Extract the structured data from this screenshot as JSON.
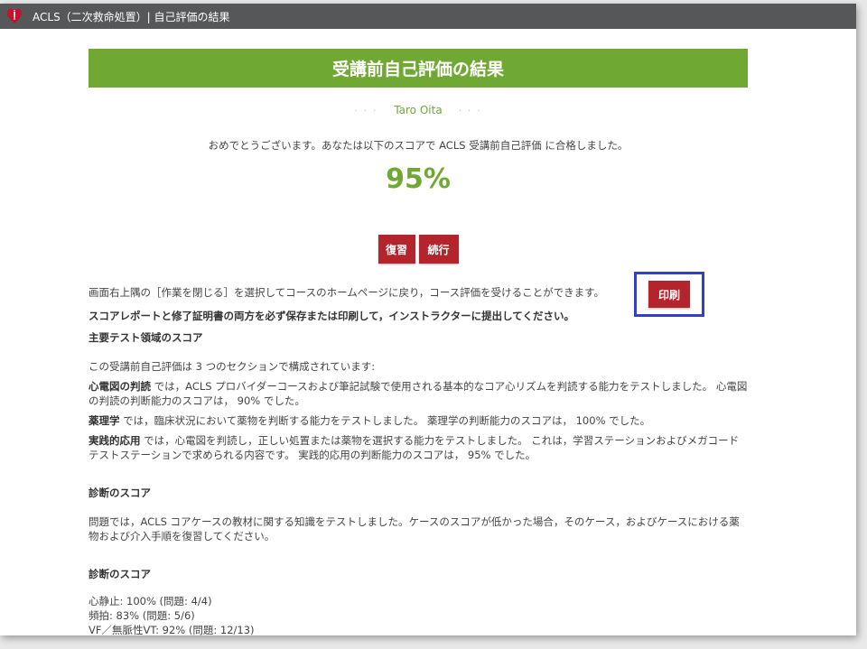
{
  "window": {
    "title": "ACLS（二次救命処置）| 自己評価の結果"
  },
  "banner": {
    "title": "受講前自己評価の結果"
  },
  "user": {
    "name": "Taro Oita"
  },
  "result": {
    "congrats": "おめでとうございます。あなたは以下のスコアで ACLS 受講前自己評価 に合格しました。",
    "score": "95%"
  },
  "buttons": {
    "review": "復習",
    "continue": "続行",
    "print": "印刷"
  },
  "info": {
    "close_instruction": "画面右上隅の［作業を閉じる］を選択してコースのホームページに戻り，コース評価を受けることができます。",
    "save_notice": "スコアレポートと修了証明書の両方を必ず保存または印刷して，インストラクターに提出してください。"
  },
  "sections": {
    "main_heading": "主要テスト領域のスコア",
    "intro": "この受講前自己評価は 3 つのセクションで構成されています:",
    "ecg": {
      "term": "心電図の判読",
      "text": " では，ACLS プロバイダーコースおよび筆記試験で使用される基本的なコア心リズムを判読する能力をテストしました。 心電図の判読の判断能力のスコアは， 90% でした。"
    },
    "pharm": {
      "term": "薬理学",
      "text": " では，臨床状況において薬物を判断する能力をテストしました。 薬理学の判断能力のスコアは， 100% でした。"
    },
    "practical": {
      "term": "実践的応用",
      "text": " では，心電図を判読し，正しい処置または薬物を選択する能力をテストしました。 これは，学習ステーションおよびメガコードテストステーションで求められる内容です。 実践的応用の判断能力のスコアは， 95% でした。"
    },
    "diag_heading_1": "診断のスコア",
    "diag_text": "問題では，ACLS コアケースの教材に関する知識をテストしました。ケースのスコアが低かった場合，そのケース，およびケースにおける薬物および介入手順を復習してください。",
    "diag_heading_2": "診断のスコア",
    "diag_items": [
      "心静止: 100% (問題: 4/4)",
      "頻拍: 83% (問題: 5/6)",
      "VF／無脈性VT: 92% (問題: 12/13)"
    ]
  },
  "colors": {
    "titlebar": "#555759",
    "accent_green": "#6fa833",
    "button_red": "#b3242c",
    "highlight_blue": "#3340c4"
  }
}
